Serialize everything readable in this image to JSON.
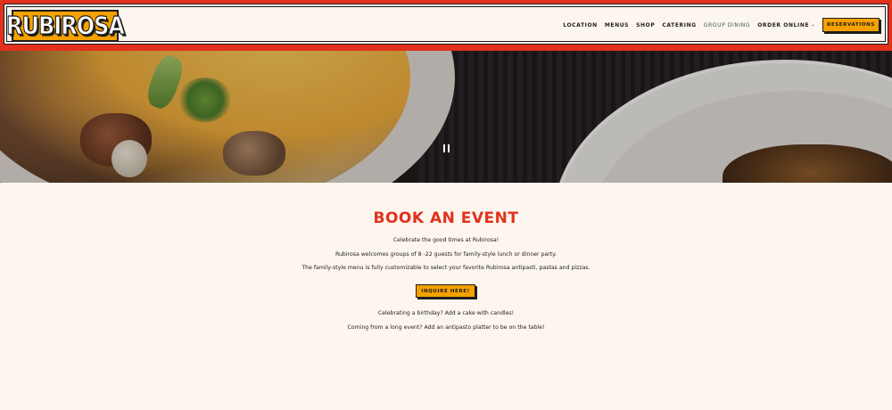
{
  "header": {
    "logo_text": "RUBIROSA",
    "nav": {
      "location": "LOCATION",
      "menus": "MENUS",
      "shop": "SHOP",
      "catering": "CATERING",
      "group_dining": "GROUP DINING",
      "order_online": "ORDER ONLINE"
    },
    "reservations_label": "RESERVATIONS"
  },
  "hero": {
    "pause_icon": "pause-icon"
  },
  "content": {
    "title": "BOOK AN EVENT",
    "line1": "Celebrate the good times at Rubirosa!",
    "line2": "Rubirosa welcomes groups of 8 -22 guests for family-style lunch or dinner party.",
    "line3": "The family-style menu is fully customizable to select your favorite Rubirosa antipasti, pastas and pizzas.",
    "inquire_label": "INQUIRE HERE!",
    "line4": "Celebrating a birthday? Add a cake with candles!",
    "line5": "Coming from a long event? Add an antipasto platter to be on the table!"
  },
  "colors": {
    "accent_red": "#e2311d",
    "accent_yellow": "#f5a100",
    "background": "#fdf6ee",
    "ink": "#1d1d1d"
  }
}
